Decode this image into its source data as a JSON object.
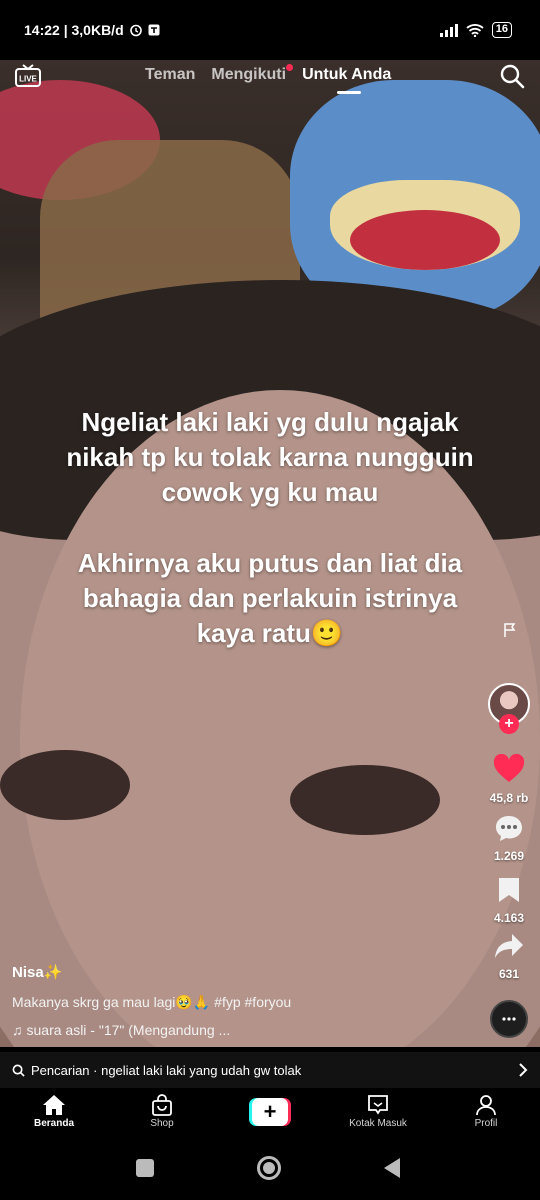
{
  "status_bar": {
    "time_speed": "14:22 | 3,0KB/d",
    "battery": "16"
  },
  "top_nav": {
    "live_label": "LIVE",
    "tabs": [
      "Teman",
      "Mengikuti",
      "Untuk Anda"
    ]
  },
  "video": {
    "overlay_lines_1": [
      "Ngeliat laki laki yg dulu ngajak",
      "nikah tp ku tolak karna nungguin",
      "cowok yg ku mau"
    ],
    "overlay_lines_2": [
      "Akhirnya aku putus dan liat dia",
      "bahagia dan perlakuin istrinya",
      "kaya ratu🙂"
    ]
  },
  "rail": {
    "likes": "45,8 rb",
    "comments": "1.269",
    "saves": "4.163",
    "shares": "631"
  },
  "post": {
    "username": "Nisa✨",
    "description": "Makanya skrg ga mau lagi🥹🙏 #fyp #foryou",
    "sound": "suara asli - \"17\" (Mengandung ..."
  },
  "search_strip": {
    "text": "Pencarian · ngeliat laki laki yang udah gw tolak"
  },
  "bottom_nav": {
    "items": [
      "Beranda",
      "Shop",
      "",
      "Kotak Masuk",
      "Profil"
    ]
  },
  "colors": {
    "accent_red": "#fe2c55",
    "accent_cyan": "#25f4ee",
    "heart": "#ff2d55"
  },
  "icons": [
    "live-icon",
    "search-icon",
    "flag-icon",
    "heart-icon",
    "comment-icon",
    "bookmark-icon",
    "share-icon",
    "music-note-icon",
    "home-icon",
    "shop-icon",
    "plus-icon",
    "inbox-icon",
    "profile-icon",
    "chevron-right-icon"
  ]
}
